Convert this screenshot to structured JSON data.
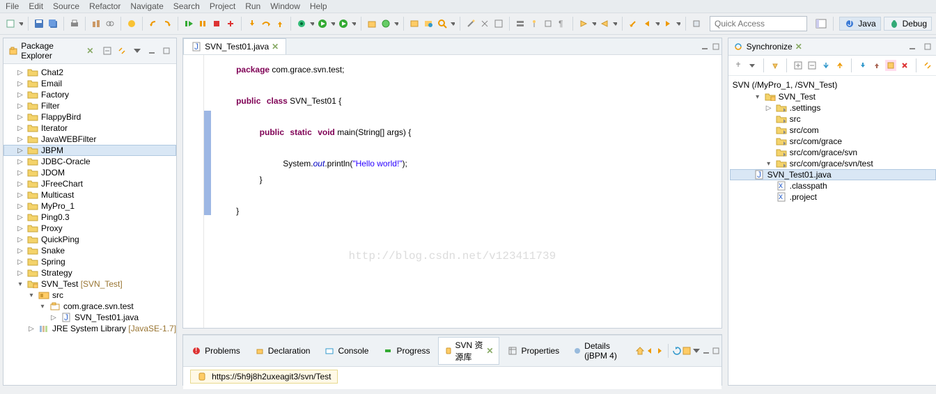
{
  "menu": [
    "File",
    "Edit",
    "Source",
    "Refactor",
    "Navigate",
    "Search",
    "Project",
    "Run",
    "Window",
    "Help"
  ],
  "quick_access_placeholder": "Quick Access",
  "perspectives": {
    "java": "Java",
    "debug": "Debug"
  },
  "package_explorer": {
    "title": "Package Explorer",
    "projects": [
      "Chat2",
      "Email",
      "Factory",
      "Filter",
      "FlappyBird",
      "Iterator",
      "JavaWEBFilter",
      "JBPM",
      "JDBC-Oracle",
      "JDOM",
      "JFreeChart",
      "Multicast",
      "MyPro_1",
      "Ping0.3",
      "Proxy",
      "QuickPing",
      "Snake",
      "Spring",
      "Strategy"
    ],
    "svn_project": {
      "label": "SVN_Test",
      "decoration": "[SVN_Test]"
    },
    "src_label": "src",
    "package_label": "com.grace.svn.test",
    "java_file": "SVN_Test01.java",
    "jre": {
      "label": "JRE System Library",
      "decoration": "[JavaSE-1.7]"
    }
  },
  "editor": {
    "tab": "SVN_Test01.java",
    "code": {
      "l1_kw": "package",
      "l1_rest": " com.grace.svn.test;",
      "l3_kw1": "public",
      "l3_kw2": "class",
      "l3_name": " SVN_Test01 {",
      "l5_kw1": "public",
      "l5_kw2": "static",
      "l5_kw3": "void",
      "l5_rest": " main(String[] args) {",
      "l7_a": "System.",
      "l7_out": "out",
      "l7_b": ".println(",
      "l7_str": "\"Hello world!\"",
      "l7_c": ");",
      "l8": "}",
      "l10": "}"
    },
    "watermark": "http://blog.csdn.net/v123411739"
  },
  "bottom": {
    "tabs": [
      "Problems",
      "Declaration",
      "Console",
      "Progress",
      "SVN 资源库",
      "Properties",
      "Details (jBPM 4)"
    ],
    "active_index": 4,
    "svn_url": "https://5h9j8h2uxeagit3/svn/Test"
  },
  "synchronize": {
    "title": "Synchronize",
    "root": "SVN (/MyPro_1, /SVN_Test)",
    "project": "SVN_Test",
    "children": [
      ".settings",
      "src",
      "src/com",
      "src/com/grace",
      "src/com/grace/svn"
    ],
    "test_pkg": "src/com/grace/svn/test",
    "java_file": "SVN_Test01.java",
    "files": [
      ".classpath",
      ".project"
    ]
  }
}
